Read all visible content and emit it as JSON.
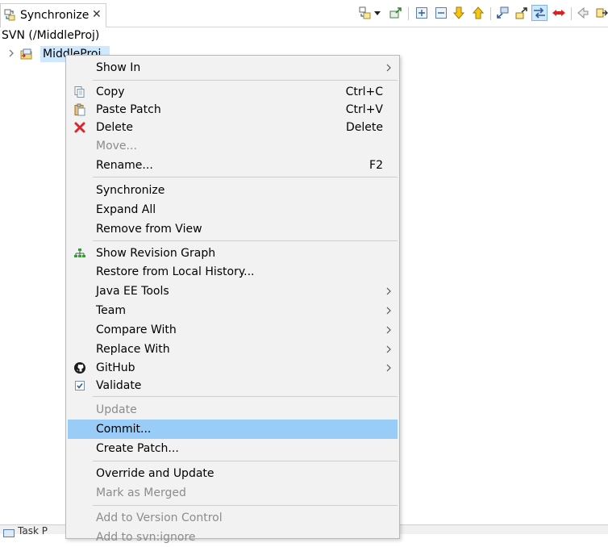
{
  "view": {
    "tab_label": "Synchronize",
    "tab_close": "✕",
    "description": "SVN (/MiddleProj)"
  },
  "toolbar": {
    "icons": [
      "sync-mode-icon",
      "view-menu-dropdown-icon",
      "pin-icon",
      "expand-all-icon",
      "collapse-all-icon",
      "next-change-icon",
      "previous-change-icon",
      "incoming-mode-icon",
      "outgoing-mode-icon",
      "both-modes-icon",
      "conflicts-mode-icon",
      "back-icon",
      "forward-icon"
    ]
  },
  "tree": {
    "project_label": "MiddleProj"
  },
  "bottom": {
    "partial_label": "Task P"
  },
  "menu": {
    "show_in": "Show In",
    "copy": "Copy",
    "copy_shortcut": "Ctrl+C",
    "paste_patch": "Paste Patch",
    "paste_patch_shortcut": "Ctrl+V",
    "delete": "Delete",
    "delete_shortcut": "Delete",
    "move": "Move...",
    "rename": "Rename...",
    "rename_shortcut": "F2",
    "synchronize": "Synchronize",
    "expand_all": "Expand All",
    "remove_from_view": "Remove from View",
    "show_revision_graph": "Show Revision Graph",
    "restore_local_history": "Restore from Local History...",
    "java_ee_tools": "Java EE Tools",
    "team": "Team",
    "compare_with": "Compare With",
    "replace_with": "Replace With",
    "github": "GitHub",
    "validate": "Validate",
    "update": "Update",
    "commit": "Commit...",
    "create_patch": "Create Patch...",
    "override_update": "Override and Update",
    "mark_merged": "Mark as Merged",
    "add_version_control": "Add to Version Control",
    "add_partial": "Add to svn:ignore"
  },
  "colors": {
    "selection": "#99ccf7",
    "tree_selection": "#cde8ff",
    "menu_bg": "#f2f2f2",
    "disabled_text": "#8c8c8c"
  }
}
